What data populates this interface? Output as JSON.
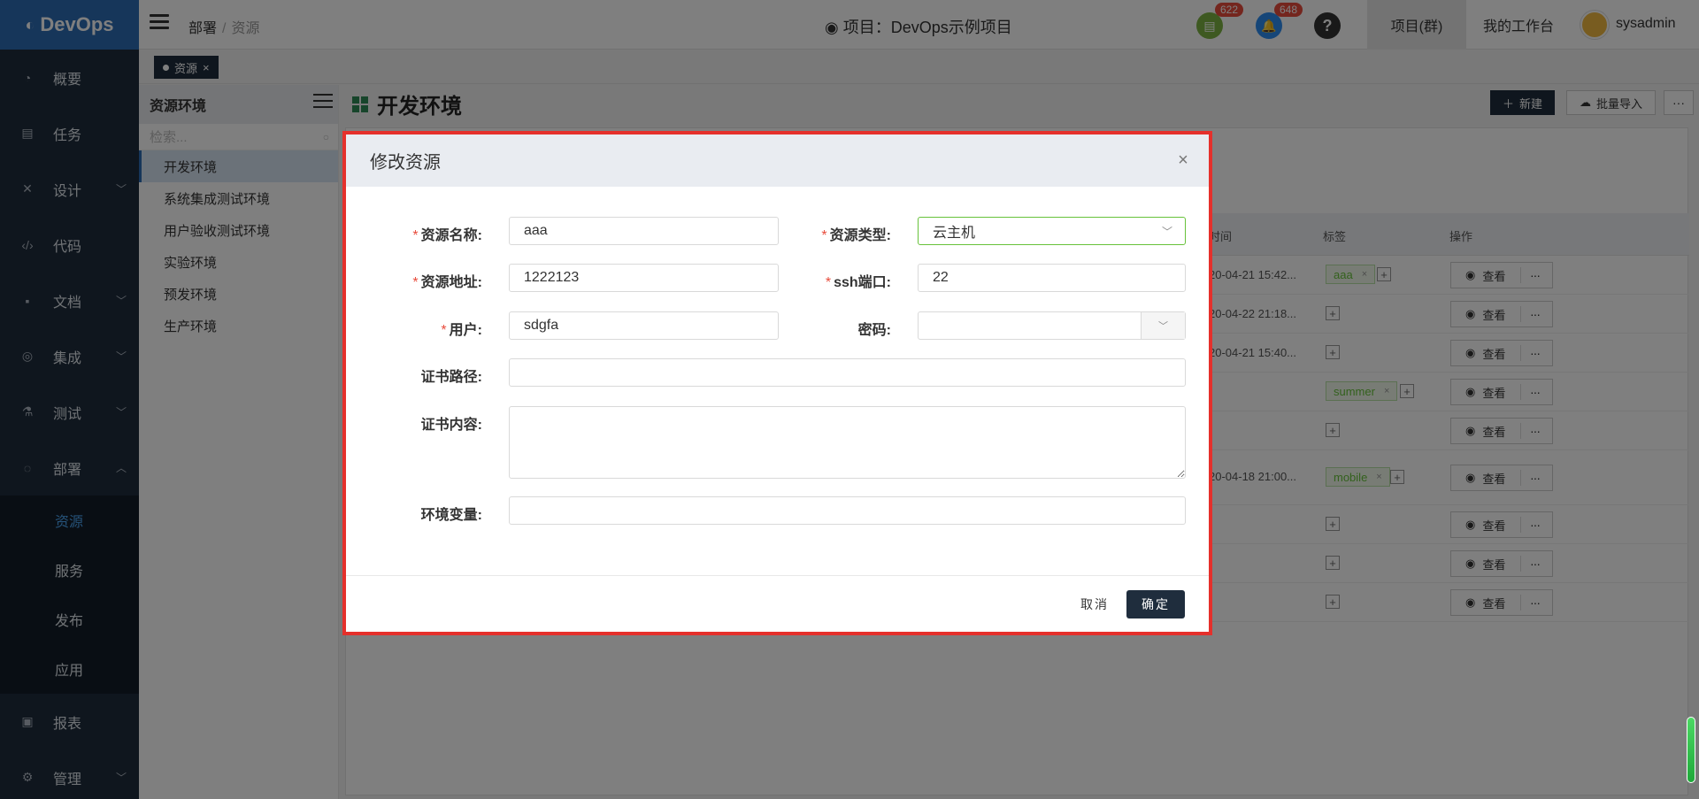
{
  "app": {
    "logo_text": "DevOps"
  },
  "sidebar": {
    "items": [
      {
        "label": "概要"
      },
      {
        "label": "任务"
      },
      {
        "label": "设计"
      },
      {
        "label": "代码"
      },
      {
        "label": "文档"
      },
      {
        "label": "集成"
      },
      {
        "label": "测试"
      },
      {
        "label": "部署"
      }
    ],
    "sub_items": [
      {
        "label": "资源"
      },
      {
        "label": "服务"
      },
      {
        "label": "发布"
      },
      {
        "label": "应用"
      }
    ],
    "bottom_items": [
      {
        "label": "报表"
      },
      {
        "label": "管理"
      }
    ]
  },
  "header": {
    "breadcrumb": {
      "parent": "部署",
      "sep": "/",
      "current": "资源"
    },
    "project": "项目：DevOps示例项目",
    "badges": {
      "doc": "622",
      "bell": "648"
    },
    "help": "?",
    "tabs": {
      "project_group": "项目(群)",
      "workspace": "我的工作台"
    },
    "user": "sysadmin"
  },
  "page_tabs": [
    {
      "label": "资源",
      "close": "×"
    }
  ],
  "env_panel": {
    "title": "资源环境",
    "search_placeholder": "检索...",
    "items": [
      "开发环境",
      "系统集成测试环境",
      "用户验收测试环境",
      "实验环境",
      "预发环境",
      "生产环境"
    ]
  },
  "main": {
    "title": "开发环境",
    "new_button": "新建",
    "import_button": "批量导入",
    "more": "···",
    "columns": {
      "time": "时间",
      "tags": "标签",
      "ops": "操作"
    },
    "rows": [
      {
        "time": "20-04-21 15:42...",
        "tag": "aaa"
      },
      {
        "time": "20-04-22 21:18...",
        "tag": ""
      },
      {
        "time": "20-04-21 15:40...",
        "tag": ""
      },
      {
        "time": "",
        "tag": "summer"
      },
      {
        "time": "",
        "tag": ""
      },
      {
        "time": "20-04-18 21:00...",
        "tag": "mobile"
      },
      {
        "time": "",
        "tag": ""
      },
      {
        "time": "",
        "tag": ""
      },
      {
        "time": "",
        "tag": ""
      }
    ],
    "view_label": "查看",
    "row_more": "···"
  },
  "modal": {
    "title": "修改资源",
    "close": "×",
    "fields": {
      "name": {
        "label": "资源名称:",
        "value": "aaa"
      },
      "type": {
        "label": "资源类型:",
        "value": "云主机"
      },
      "address": {
        "label": "资源地址:",
        "value": "1222123"
      },
      "ssh_port": {
        "label": "ssh端口:",
        "value": "22"
      },
      "user": {
        "label": "用户:",
        "value": "sdgfa"
      },
      "password": {
        "label": "密码:",
        "value": ""
      },
      "cert_path": {
        "label": "证书路径:",
        "value": ""
      },
      "cert_content": {
        "label": "证书内容:",
        "value": ""
      },
      "env_vars": {
        "label": "环境变量:",
        "value": ""
      }
    },
    "required_mark": "*",
    "cancel": "取消",
    "ok": "确定"
  },
  "colors": {
    "sidebar": "#1f2d3d",
    "logo": "#2d6db4",
    "accent": "#4aa3f0",
    "highlight": "#e5302b",
    "tag_green": "#67c23a"
  }
}
